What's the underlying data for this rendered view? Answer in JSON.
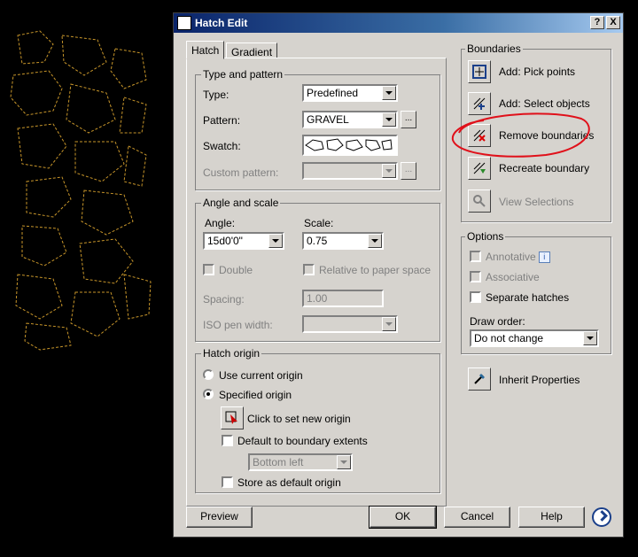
{
  "window": {
    "title": "Hatch Edit",
    "help_label": "?",
    "close_label": "X"
  },
  "tabs": [
    {
      "label": "Hatch"
    },
    {
      "label": "Gradient"
    }
  ],
  "type_pattern": {
    "group_label": "Type and pattern",
    "type_label": "Type:",
    "type_value": "Predefined",
    "pattern_label": "Pattern:",
    "pattern_value": "GRAVEL",
    "swatch_label": "Swatch:",
    "custom_pattern_label": "Custom pattern:",
    "browse_label": "..."
  },
  "angle_scale": {
    "group_label": "Angle and scale",
    "angle_label": "Angle:",
    "angle_value": "15d0'0\"",
    "scale_label": "Scale:",
    "scale_value": "0.75",
    "double_label": "Double",
    "relative_label": "Relative to paper space",
    "spacing_label": "Spacing:",
    "spacing_value": "1.00",
    "iso_pen_label": "ISO pen width:"
  },
  "hatch_origin": {
    "group_label": "Hatch origin",
    "use_current_label": "Use current origin",
    "specified_label": "Specified origin",
    "click_set_label": "Click to set new origin",
    "default_extents_label": "Default to boundary extents",
    "extents_value": "Bottom left",
    "store_default_label": "Store as default origin"
  },
  "boundaries": {
    "group_label": "Boundaries",
    "add_pick_label": "Add: Pick points",
    "add_select_label": "Add: Select objects",
    "remove_label": "Remove boundaries",
    "recreate_label": "Recreate boundary",
    "view_label": "View Selections"
  },
  "options": {
    "group_label": "Options",
    "annotative_label": "Annotative",
    "annotative_info": "i",
    "associative_label": "Associative",
    "separate_label": "Separate hatches",
    "draw_order_label": "Draw order:",
    "draw_order_value": "Do not change"
  },
  "inherit_label": "Inherit Properties",
  "footer": {
    "preview": "Preview",
    "ok": "OK",
    "cancel": "Cancel",
    "help": "Help"
  },
  "colors": {
    "title_bar": "#0a246a",
    "dialog_bg": "#d6d3ce",
    "hatch_lines": "#d4a020",
    "annotation": "#e0101a"
  }
}
